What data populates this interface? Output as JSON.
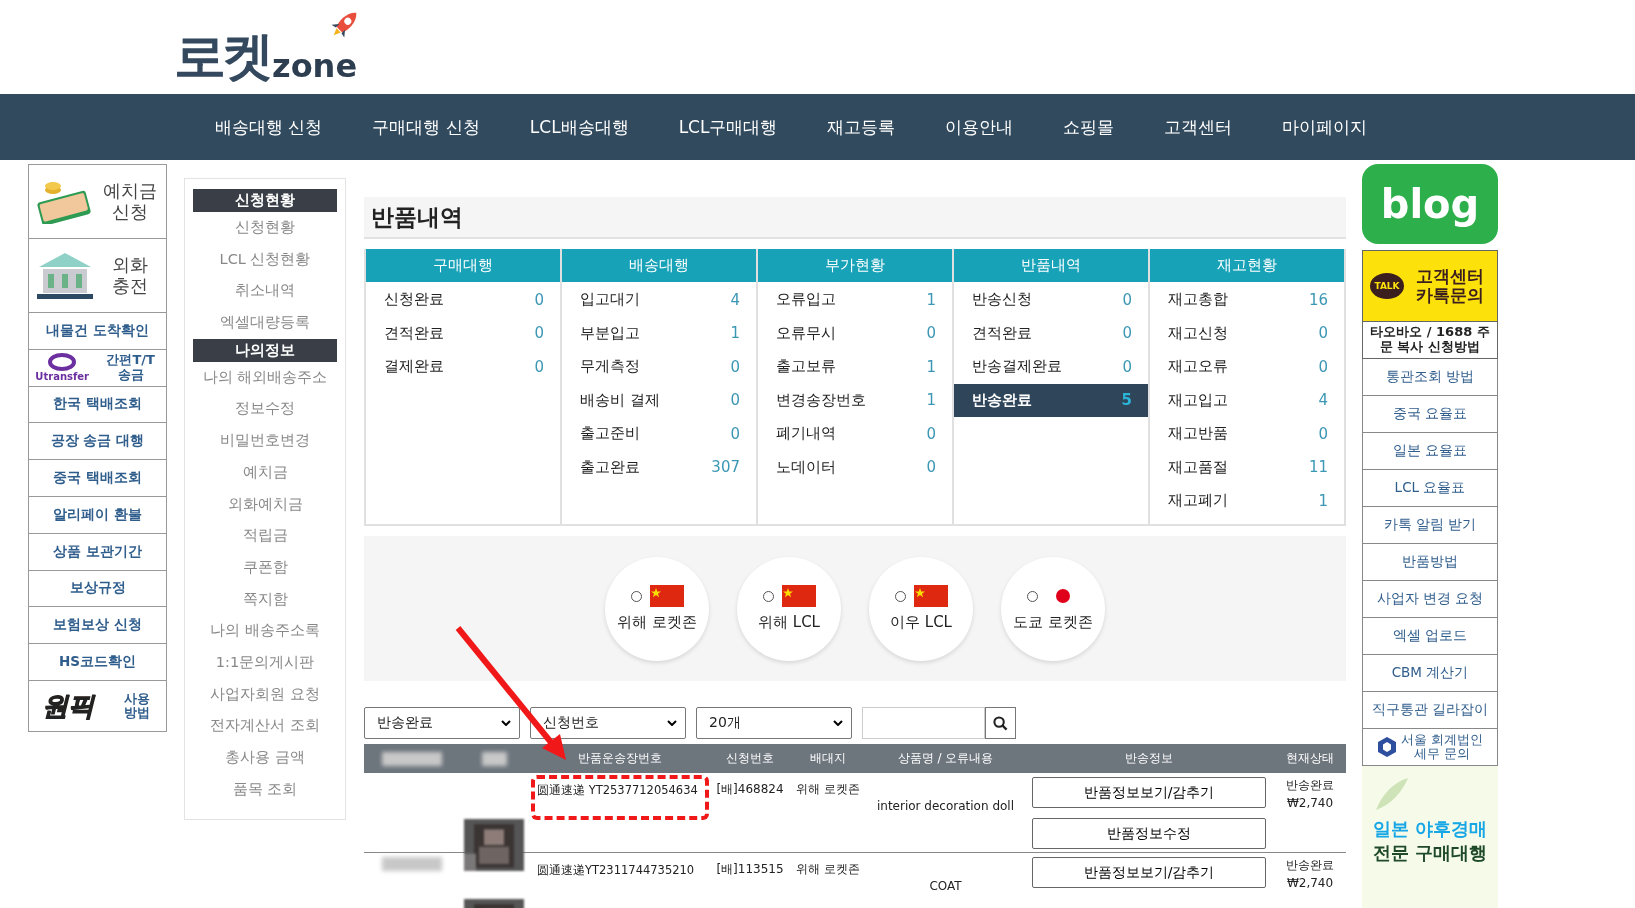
{
  "logo": {
    "main": "로켓",
    "sub": "zone"
  },
  "nav": [
    "배송대행 신청",
    "구매대행 신청",
    "LCL배송대행",
    "LCL구매대행",
    "재고등록",
    "이용안내",
    "쇼핑몰",
    "고객센터",
    "마이페이지"
  ],
  "left_banners": [
    {
      "kind": "money",
      "label": "예치금 신청"
    },
    {
      "kind": "bank",
      "label": "외화 충전"
    }
  ],
  "left_links": [
    {
      "kind": "text",
      "label": "내물건 도착확인"
    },
    {
      "kind": "utransfer",
      "brand": "Utransfer",
      "label": "간편T/T 송금"
    },
    {
      "kind": "text",
      "label": "한국 택배조회"
    },
    {
      "kind": "text",
      "label": "공장 송금 대행"
    },
    {
      "kind": "text",
      "label": "중국 택배조회"
    },
    {
      "kind": "text",
      "label": "알리페이 환불"
    },
    {
      "kind": "text",
      "label": "상품 보관기간"
    },
    {
      "kind": "text",
      "label": "보상규정"
    },
    {
      "kind": "text",
      "label": "보험보상 신청"
    },
    {
      "kind": "text",
      "label": "HS코드확인"
    },
    {
      "kind": "onepick",
      "brand": "원픽",
      "label": "사용 방법"
    }
  ],
  "menu": [
    {
      "title": "신청현황",
      "items": [
        "신청현황",
        "LCL 신청현황",
        "취소내역",
        "엑셀대량등록"
      ]
    },
    {
      "title": "나의정보",
      "items": [
        "나의 해외배송주소",
        "정보수정",
        "비밀번호변경",
        "예치금",
        "외화예치금",
        "적립금",
        "쿠폰함",
        "쪽지함",
        "나의 배송주소록",
        "1:1문의게시판",
        "사업자회원 요청",
        "전자계산서 조회",
        "총사용 금액",
        "품목 조회"
      ]
    }
  ],
  "page_title": "반품내역",
  "stats": [
    {
      "title": "구매대행",
      "rows": [
        {
          "label": "신청완료",
          "count": "0",
          "selected": false
        },
        {
          "label": "견적완료",
          "count": "0",
          "selected": false
        },
        {
          "label": "결제완료",
          "count": "0",
          "selected": false
        }
      ]
    },
    {
      "title": "배송대행",
      "rows": [
        {
          "label": "입고대기",
          "count": "4",
          "selected": false
        },
        {
          "label": "부분입고",
          "count": "1",
          "selected": false
        },
        {
          "label": "무게측정",
          "count": "0",
          "selected": false
        },
        {
          "label": "배송비 결제",
          "count": "0",
          "selected": false
        },
        {
          "label": "출고준비",
          "count": "0",
          "selected": false
        },
        {
          "label": "출고완료",
          "count": "307",
          "selected": false
        }
      ]
    },
    {
      "title": "부가현황",
      "rows": [
        {
          "label": "오류입고",
          "count": "1",
          "selected": false
        },
        {
          "label": "오류무시",
          "count": "0",
          "selected": false
        },
        {
          "label": "출고보류",
          "count": "1",
          "selected": false
        },
        {
          "label": "변경송장번호",
          "count": "1",
          "selected": false
        },
        {
          "label": "폐기내역",
          "count": "0",
          "selected": false
        },
        {
          "label": "노데이터",
          "count": "0",
          "selected": false
        }
      ]
    },
    {
      "title": "반품내역",
      "rows": [
        {
          "label": "반송신청",
          "count": "0",
          "selected": false
        },
        {
          "label": "견적완료",
          "count": "0",
          "selected": false
        },
        {
          "label": "반송결제완료",
          "count": "0",
          "selected": false
        },
        {
          "label": "반송완료",
          "count": "5",
          "selected": true
        }
      ]
    },
    {
      "title": "재고현황",
      "rows": [
        {
          "label": "재고총합",
          "count": "16",
          "selected": false
        },
        {
          "label": "재고신청",
          "count": "0",
          "selected": false
        },
        {
          "label": "재고오류",
          "count": "0",
          "selected": false
        },
        {
          "label": "재고입고",
          "count": "4",
          "selected": false
        },
        {
          "label": "재고반품",
          "count": "0",
          "selected": false
        },
        {
          "label": "재고품절",
          "count": "11",
          "selected": false
        },
        {
          "label": "재고폐기",
          "count": "1",
          "selected": false
        }
      ]
    }
  ],
  "warehouses": [
    {
      "kind": "china",
      "label": "위해 로켓존",
      "selected": false
    },
    {
      "kind": "china",
      "label": "위해 LCL",
      "selected": false
    },
    {
      "kind": "china",
      "label": "이우 LCL",
      "selected": false
    },
    {
      "kind": "japan",
      "label": "도쿄 로켓존",
      "selected": false
    }
  ],
  "filters": {
    "status": "반송완료",
    "field": "신청번호",
    "per_page": "20개"
  },
  "table": {
    "columns": [
      "반품운송장번호",
      "신청번호",
      "배대지",
      "상품명 / 오류내용",
      "반송정보",
      "현재상태"
    ],
    "rows": [
      {
        "tracking": "圆通速递 YT2537712054634",
        "order": "[배]468824",
        "warehouse": "위해 로켓존",
        "product": "interior decoration doll",
        "buttons": [
          "반품정보보기/감추기",
          "반품정보수정"
        ],
        "status": "반송완료",
        "amount": "₩2,740",
        "highlighted": true
      },
      {
        "tracking": "圆通速递YT2311744735210",
        "order": "[배]113515",
        "warehouse": "위해 로켓존",
        "product": "COAT",
        "buttons": [
          "반품정보보기/감추기"
        ],
        "status": "반송완료",
        "amount": "₩2,740",
        "highlighted": false
      }
    ]
  },
  "right_banners": {
    "blog": "blog",
    "talk_badge": "TALK",
    "talk": "고객센터 카톡문의",
    "order_copy": "타오바오 / 1688 주문 복사 신청방법"
  },
  "right_links": [
    {
      "kind": "text",
      "label": "통관조회 방법"
    },
    {
      "kind": "text",
      "label": "중국 요율표"
    },
    {
      "kind": "text",
      "label": "일본 요율표"
    },
    {
      "kind": "text",
      "label": "LCL 요율표"
    },
    {
      "kind": "text",
      "label": "카톡 알림 받기"
    },
    {
      "kind": "text",
      "label": "반품방법"
    },
    {
      "kind": "text",
      "label": "사업자 변경 요청"
    },
    {
      "kind": "text",
      "label": "엑셀 업로드"
    },
    {
      "kind": "text",
      "label": "CBM 계산기"
    },
    {
      "kind": "text",
      "label": "직구통관 길라잡이"
    },
    {
      "kind": "logo",
      "label": "서울 회계법인 세무 문의"
    }
  ],
  "auction_banner": {
    "line_1": "일본 야후경매",
    "line_2": "전문 구매대행"
  }
}
